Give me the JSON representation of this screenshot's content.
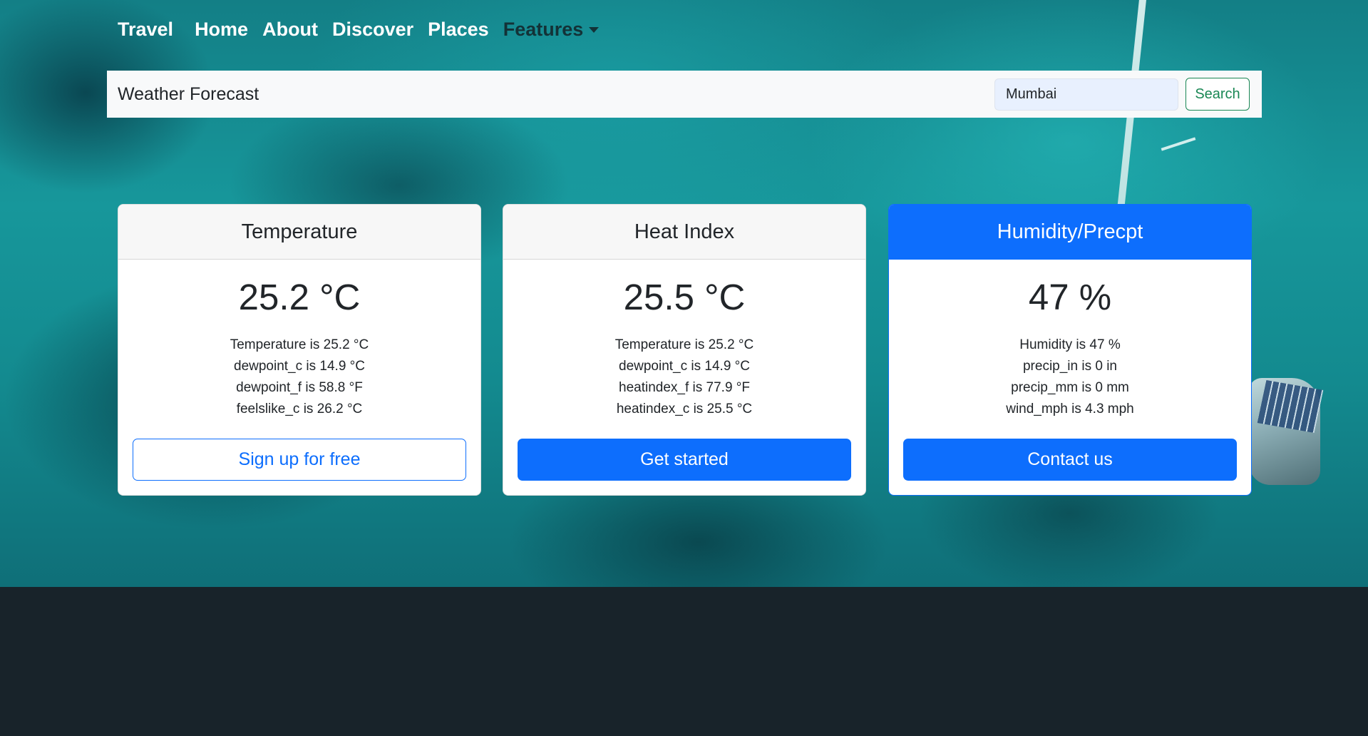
{
  "nav": {
    "brand": "Travel",
    "items": [
      "Home",
      "About",
      "Discover",
      "Places"
    ],
    "dropdown_label": "Features"
  },
  "search": {
    "title": "Weather Forecast",
    "value": "Mumbai",
    "button_label": "Search"
  },
  "cards": [
    {
      "header": "Temperature",
      "value": "25.2 °C",
      "lines": [
        "Temperature is 25.2 °C",
        "dewpoint_c is 14.9 °C",
        "dewpoint_f is 58.8 °F",
        "feelslike_c is 26.2 °C"
      ],
      "button_label": "Sign up for free"
    },
    {
      "header": "Heat Index",
      "value": "25.5 °C",
      "lines": [
        "Temperature is 25.2 °C",
        "dewpoint_c is 14.9 °C",
        "heatindex_f is 77.9 °F",
        "heatindex_c is 25.5 °C"
      ],
      "button_label": "Get started"
    },
    {
      "header": "Humidity/Precpt",
      "value": "47 %",
      "lines": [
        "Humidity is 47 %",
        "precip_in is 0 in",
        "precip_mm is 0 mm",
        "wind_mph is 4.3 mph"
      ],
      "button_label": "Contact us"
    }
  ],
  "colors": {
    "primary": "#0d6efd",
    "success": "#198754",
    "footer": "#18232a",
    "ocean": "#17979b"
  }
}
